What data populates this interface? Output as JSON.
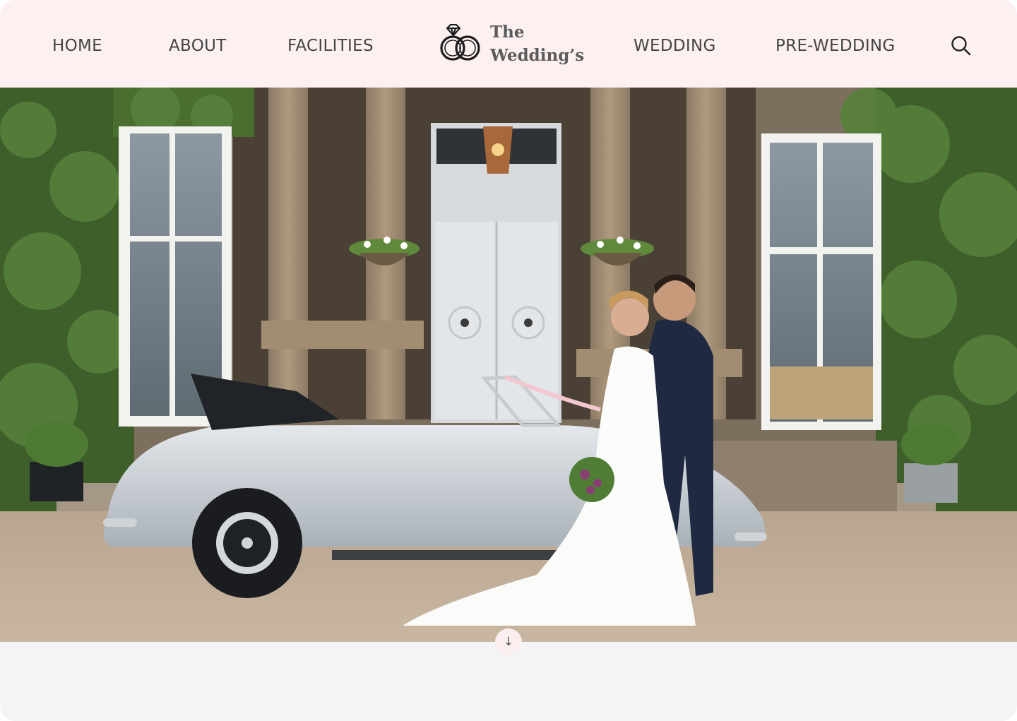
{
  "nav": {
    "left": [
      {
        "label": "HOME"
      },
      {
        "label": "ABOUT"
      },
      {
        "label": "FACILITIES"
      }
    ],
    "right": [
      {
        "label": "WEDDING"
      },
      {
        "label": "PRE-WEDDING"
      }
    ]
  },
  "logo": {
    "line1": "The",
    "line2": "Wedding’s",
    "icon": "wedding-rings-icon"
  },
  "search": {
    "icon": "search-icon"
  },
  "hero": {
    "image": "bride-and-groom-beside-vintage-convertible-car-photo"
  },
  "scroll": {
    "icon": "arrow-down-icon",
    "glyph": "↓"
  },
  "colors": {
    "header_bg": "#fcf0f0",
    "nav_text": "#444444",
    "page_bg": "#f4f4f4",
    "scroll_button_bg": "#fbeeee"
  }
}
